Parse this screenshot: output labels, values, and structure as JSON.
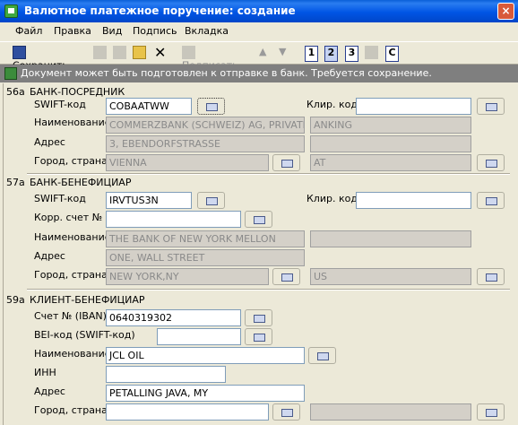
{
  "window": {
    "title": "Валютное платежное поручение: создание",
    "close": "×"
  },
  "menu": [
    "Файл",
    "Правка",
    "Вид",
    "Подпись",
    "Вкладка"
  ],
  "toolbar": {
    "save_label": "Сохранить",
    "sign_label": "Подписать",
    "tabs": [
      "1",
      "2",
      "3",
      "C"
    ]
  },
  "info": "Документ может быть подготовлен к отправке в банк. Требуется сохранение.",
  "labels": {
    "swift": "SWIFT-код",
    "clearing": "Клир. код",
    "name": "Наименование",
    "address": "Адрес",
    "city_country": "Город, страна",
    "corr_account": "Корр. счет №",
    "account_iban": "Счет № (IBAN)",
    "bei": "BEI-код (SWIFT-код)",
    "inn": "ИНН"
  },
  "sections": {
    "intermediary": {
      "num": "56a",
      "title": "БАНК-ПОСРЕДНИК",
      "swift": "COBAATWW",
      "clearing": "",
      "name": "COMMERZBANK (SCHWEIZ) AG, PRIVATE B",
      "name2": "ANKING",
      "address": "3, EBENDORFSTRASSE",
      "city": "VIENNA",
      "country": "AT"
    },
    "beneficiary_bank": {
      "num": "57a",
      "title": "БАНК-БЕНЕФИЦИАР",
      "swift": "IRVTUS3N",
      "clearing": "",
      "corr_account": "",
      "name": "THE BANK OF NEW YORK MELLON",
      "name2": "",
      "address": "ONE, WALL STREET",
      "city": "NEW YORK,NY",
      "country": "US"
    },
    "beneficiary": {
      "num": "59a",
      "title": "КЛИЕНТ-БЕНЕФИЦИАР",
      "account": "0640319302",
      "bei": "",
      "name": "JCL OIL",
      "inn": "",
      "address": "PETALLING JAVA, MY",
      "city": "",
      "country": ""
    }
  }
}
